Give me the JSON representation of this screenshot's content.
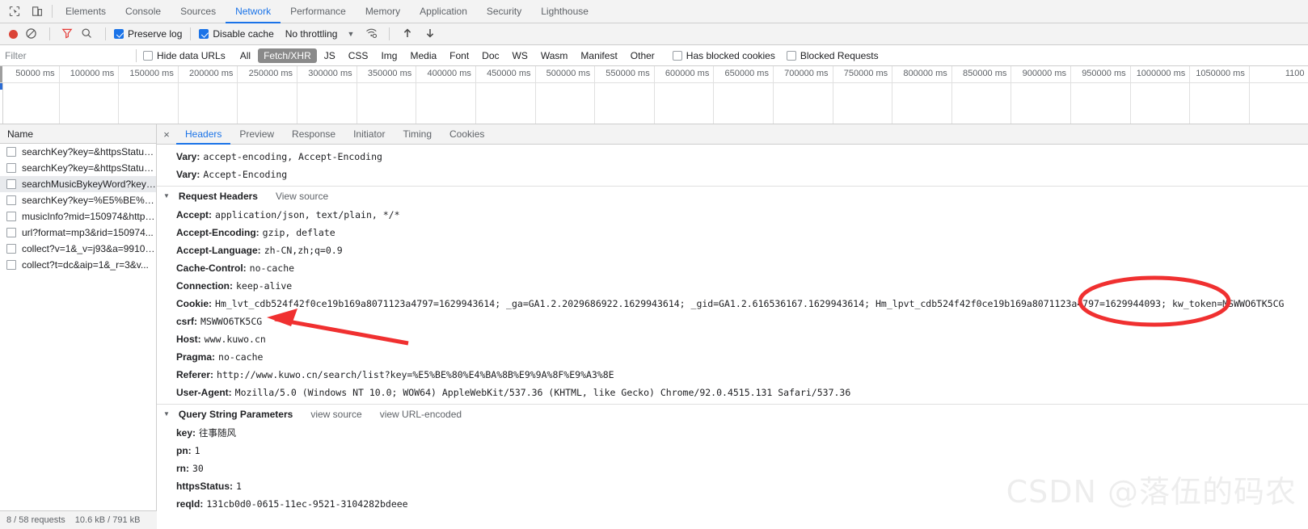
{
  "window": {
    "tabs": [
      {
        "label": "Elements",
        "selected": false
      },
      {
        "label": "Console",
        "selected": false
      },
      {
        "label": "Sources",
        "selected": false
      },
      {
        "label": "Network",
        "selected": true
      },
      {
        "label": "Performance",
        "selected": false
      },
      {
        "label": "Memory",
        "selected": false
      },
      {
        "label": "Application",
        "selected": false
      },
      {
        "label": "Security",
        "selected": false
      },
      {
        "label": "Lighthouse",
        "selected": false
      }
    ],
    "icons": [
      "inspect-element-icon",
      "device-toolbar-icon"
    ]
  },
  "toolbar": {
    "record_icon": "record-icon",
    "clear_icon": "clear-icon",
    "filter_icon": "filter-funnel-icon",
    "search_icon": "search-icon",
    "preserve_log": {
      "label": "Preserve log",
      "checked": true
    },
    "disable_cache": {
      "label": "Disable cache",
      "checked": true
    },
    "throttling": "No throttling",
    "caret": "▼",
    "wifi_icon": "network-conditions-icon",
    "import_icon": "import-har-icon",
    "export_icon": "export-har-icon",
    "record_color": "#db4437",
    "accent_color": "#1a73e8"
  },
  "filter_bar": {
    "input_value": "",
    "input_placeholder": "Filter",
    "hide_data_urls": {
      "label": "Hide data URLs",
      "checked": false
    },
    "types": [
      {
        "label": "All",
        "active": false
      },
      {
        "label": "Fetch/XHR",
        "active": true
      },
      {
        "label": "JS",
        "active": false
      },
      {
        "label": "CSS",
        "active": false
      },
      {
        "label": "Img",
        "active": false
      },
      {
        "label": "Media",
        "active": false
      },
      {
        "label": "Font",
        "active": false
      },
      {
        "label": "Doc",
        "active": false
      },
      {
        "label": "WS",
        "active": false
      },
      {
        "label": "Wasm",
        "active": false
      },
      {
        "label": "Manifest",
        "active": false
      },
      {
        "label": "Other",
        "active": false
      }
    ],
    "has_blocked_cookies": {
      "label": "Has blocked cookies",
      "checked": false
    },
    "blocked_requests": {
      "label": "Blocked Requests",
      "checked": false
    }
  },
  "timeline": {
    "ticks": [
      "50000 ms",
      "100000 ms",
      "150000 ms",
      "200000 ms",
      "250000 ms",
      "300000 ms",
      "350000 ms",
      "400000 ms",
      "450000 ms",
      "500000 ms",
      "550000 ms",
      "600000 ms",
      "650000 ms",
      "700000 ms",
      "750000 ms",
      "800000 ms",
      "850000 ms",
      "900000 ms",
      "950000 ms",
      "1000000 ms",
      "1050000 ms",
      "1100"
    ]
  },
  "sidebar": {
    "column_header": "Name",
    "requests": [
      {
        "name": "searchKey?key=&httpsStatus...",
        "selected": false
      },
      {
        "name": "searchKey?key=&httpsStatus...",
        "selected": false
      },
      {
        "name": "searchMusicBykeyWord?key=...",
        "selected": true
      },
      {
        "name": "searchKey?key=%E5%BE%80...",
        "selected": false
      },
      {
        "name": "musicInfo?mid=150974&https...",
        "selected": false
      },
      {
        "name": "url?format=mp3&rid=150974...",
        "selected": false
      },
      {
        "name": "collect?v=1&_v=j93&a=99100...",
        "selected": false
      },
      {
        "name": "collect?t=dc&aip=1&_r=3&v...",
        "selected": false
      }
    ],
    "status": {
      "requests": "8 / 58 requests",
      "transferred": "10.6 kB / 791 kB"
    }
  },
  "detail": {
    "close_label": "×",
    "tabs": [
      {
        "label": "Headers",
        "selected": true
      },
      {
        "label": "Preview",
        "selected": false
      },
      {
        "label": "Response",
        "selected": false
      },
      {
        "label": "Initiator",
        "selected": false
      },
      {
        "label": "Timing",
        "selected": false
      },
      {
        "label": "Cookies",
        "selected": false
      }
    ],
    "response_headers_tail": [
      {
        "key": "Vary:",
        "value": "accept-encoding, Accept-Encoding"
      },
      {
        "key": "Vary:",
        "value": "Accept-Encoding"
      }
    ],
    "request_headers_section": {
      "title": "Request Headers",
      "view_source": "View source",
      "rows": [
        {
          "key": "Accept:",
          "value": "application/json, text/plain, */*"
        },
        {
          "key": "Accept-Encoding:",
          "value": "gzip, deflate"
        },
        {
          "key": "Accept-Language:",
          "value": "zh-CN,zh;q=0.9"
        },
        {
          "key": "Cache-Control:",
          "value": "no-cache"
        },
        {
          "key": "Connection:",
          "value": "keep-alive"
        },
        {
          "key": "Cookie:",
          "value": "Hm_lvt_cdb524f42f0ce19b169a8071123a4797=1629943614; _ga=GA1.2.2029686922.1629943614; _gid=GA1.2.616536167.1629943614; Hm_lpvt_cdb524f42f0ce19b169a8071123a4797=1629944093; kw_token=MSWWO6TK5CG"
        },
        {
          "key": "csrf:",
          "value": "MSWWO6TK5CG"
        },
        {
          "key": "Host:",
          "value": "www.kuwo.cn"
        },
        {
          "key": "Pragma:",
          "value": "no-cache"
        },
        {
          "key": "Referer:",
          "value": "http://www.kuwo.cn/search/list?key=%E5%BE%80%E4%BA%8B%E9%9A%8F%E9%A3%8E"
        },
        {
          "key": "User-Agent:",
          "value": "Mozilla/5.0 (Windows NT 10.0; WOW64) AppleWebKit/537.36 (KHTML, like Gecko) Chrome/92.0.4515.131 Safari/537.36"
        }
      ]
    },
    "query_params_section": {
      "title": "Query String Parameters",
      "view_source": "view source",
      "view_url_encoded": "view URL-encoded",
      "rows": [
        {
          "key": "key:",
          "value": "往事随风",
          "cjk": true
        },
        {
          "key": "pn:",
          "value": "1",
          "cjk": false
        },
        {
          "key": "rn:",
          "value": "30",
          "cjk": false
        },
        {
          "key": "httpsStatus:",
          "value": "1",
          "cjk": false
        },
        {
          "key": "reqId:",
          "value": "131cb0d0-0615-11ec-9521-3104282bdeee",
          "cjk": false
        }
      ]
    }
  },
  "annotations": {
    "color": "#f03030",
    "ellipse_target": "kw_token=MSWWO6TK5CG",
    "arrow_target": "csrf: MSWWO6TK5CG",
    "watermark": "CSDN @落伍的码农"
  }
}
